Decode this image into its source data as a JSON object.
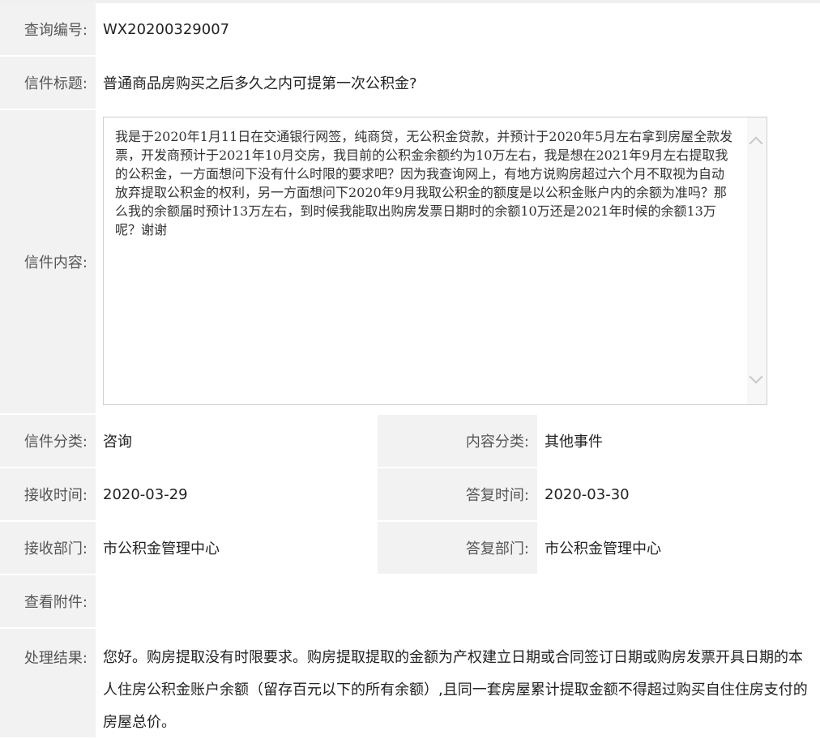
{
  "fields": {
    "query_id": {
      "label": "查询编号:",
      "value": "WX20200329007"
    },
    "letter_title": {
      "label": "信件标题:",
      "value": "普通商品房购买之后多久之内可提第一次公积金?"
    },
    "letter_content": {
      "label": "信件内容:",
      "value": "我是于2020年1月11日在交通银行网签，纯商贷，无公积金贷款，并预计于2020年5月左右拿到房屋全款发票，开发商预计于2021年10月交房，我目前的公积金余额约为10万左右，我是想在2021年9月左右提取我的公积金，一方面想问下没有什么时限的要求吧？因为我查询网上，有地方说购房超过六个月不取视为自动放弃提取公积金的权利，另一方面想问下2020年9月我取公积金的额度是以公积金账户内的余额为准吗？那么我的余额届时预计13万左右，到时候我能取出购房发票日期时的余额10万还是2021年时候的余额13万呢？谢谢"
    },
    "letter_category": {
      "label": "信件分类:",
      "value": "咨询"
    },
    "content_category": {
      "label": "内容分类:",
      "value": "其他事件"
    },
    "receive_time": {
      "label": "接收时间:",
      "value": "2020-03-29"
    },
    "reply_time": {
      "label": "答复时间:",
      "value": "2020-03-30"
    },
    "receive_dept": {
      "label": "接收部门:",
      "value": "市公积金管理中心"
    },
    "reply_dept": {
      "label": "答复部门:",
      "value": "市公积金管理中心"
    },
    "attachments": {
      "label": "查看附件:",
      "value": ""
    },
    "result": {
      "label": "处理结果:",
      "value": "您好。购房提取没有时限要求。购房提取提取的金额为产权建立日期或合同签订日期或购房发票开具日期的本人住房公积金账户余额（留存百元以下的所有余额）,且同一套房屋累计提取金额不得超过购买自住住房支付的房屋总价。"
    }
  },
  "colors": {
    "label_bg": "#f2f2f2",
    "border": "#cfcfcf"
  },
  "icons": {
    "scroll_up": "chevron-up-icon",
    "scroll_down": "chevron-down-icon"
  }
}
